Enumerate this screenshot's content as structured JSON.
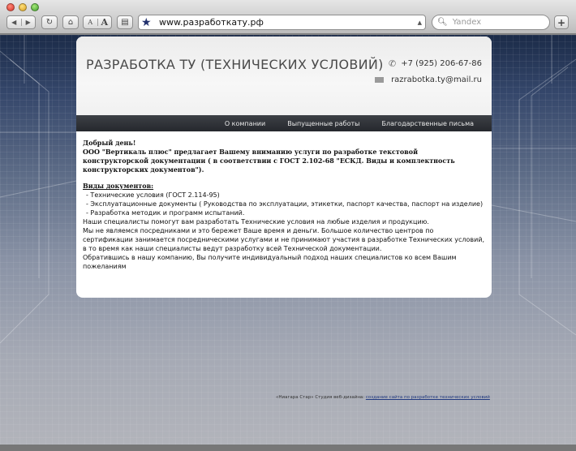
{
  "browser": {
    "url": "www.разработкату.рф",
    "search_placeholder": "Yandex",
    "font_small": "A",
    "font_large": "A"
  },
  "site": {
    "title": "РАЗРАБОТКА ТУ (ТЕХНИЧЕСКИХ УСЛОВИЙ)",
    "phone": "+7 (925) 206-67-86",
    "email": "razrabotka.ty@mail.ru"
  },
  "menu": [
    {
      "label": "О компании"
    },
    {
      "label": "Выпущенные работы"
    },
    {
      "label": "Благодарственные письма"
    }
  ],
  "content": {
    "greeting": "Добрый день!",
    "intro": "ООО \"Вертикаль плюс\" предлагает Вашему вниманию услуги по разработке текстовой конструкторской документации ( в соответствии с ГОСТ 2.102-68 \"ЕСКД. Виды и комплектность конструкторских документов\").",
    "doc_types_heading": "Виды документов:",
    "doc_types": [
      "- Технические условия (ГОСТ 2.114-95)",
      "- Эксплуатационные документы ( Руководства по эксплуатации, этикетки, паспорт качества, паспорт на изделие)",
      "- Разработка методик и программ испытаний."
    ],
    "paragraphs": [
      "Наши специалисты помогут вам разработать Технические условия на любые изделия и продукцию.",
      "Мы не являемся посредниками и это бережет Ваше время и деньги. Большое количество центров по сертификации занимается посредническими услугами и не принимают участия в разработке Технических условий, в то время как наши специалисты ведут разработку всей Технической документации.",
      "Обратившись в нашу компанию, Вы получите индивидуальный подход наших специалистов ко всем Вашим пожеланиям"
    ]
  },
  "footer": {
    "prefix": "«Ниагара Стар» Студия веб-дизайна: ",
    "link": "создание сайта по разработке технических условий"
  },
  "colors": {
    "menu_bg": "#2e3136",
    "page_bg_top": "#1b2b48",
    "page_bg_bottom": "#b2b4bb",
    "bookmark_star": "#23326e"
  }
}
